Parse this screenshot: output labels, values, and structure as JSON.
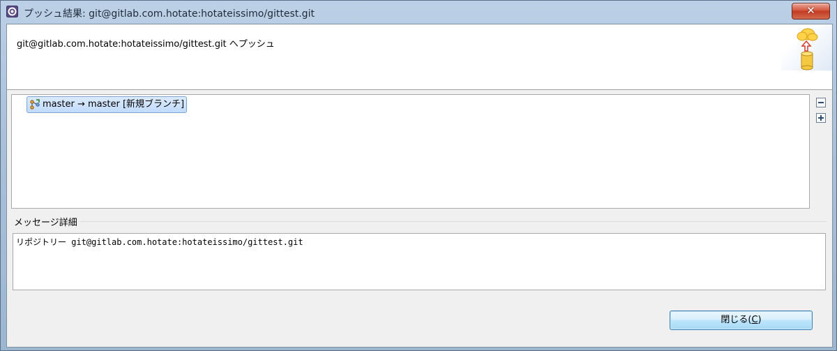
{
  "window": {
    "title": "プッシュ結果: git@gitlab.com.hotate:hotateissimo/gittest.git",
    "close_glyph": "✕"
  },
  "header": {
    "message": "git@gitlab.com.hotate:hotateissimo/gittest.git へプッシュ",
    "icon": "cloud-push-icon"
  },
  "tree": {
    "items": [
      {
        "label": "master → master [新規ブランチ]",
        "icon": "branch-push-icon"
      }
    ],
    "collapse_icon": "collapse-all-icon",
    "expand_icon": "expand-all-icon"
  },
  "details": {
    "label": "メッセージ詳細",
    "text": "リポジトリー git@gitlab.com.hotate:hotateissimo/gittest.git"
  },
  "buttons": {
    "close_label_prefix": "閉じる(",
    "close_mnemonic": "C",
    "close_label_suffix": ")"
  },
  "colors": {
    "selection": "#c1dbfc",
    "button_accent": "#3c7fb1"
  }
}
